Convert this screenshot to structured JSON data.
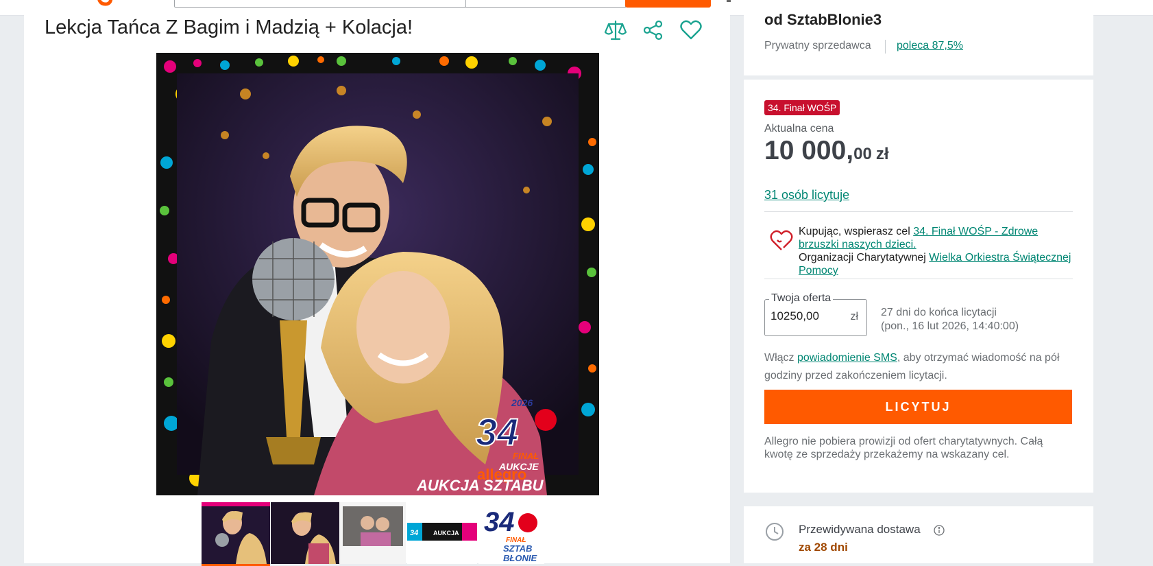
{
  "product": {
    "title": "Lekcja Tańca Z Bagim i Madzią + Kolacja!",
    "photo": {
      "logo_year": "2026",
      "logo_number": "34",
      "logo_final": "FINAŁ",
      "logo_aukcje": "AUKCJE",
      "logo_brand": "allegro",
      "banner": "AUKCJA SZTABU"
    },
    "thumbnails": [
      {
        "label": "zdjęcie 1",
        "selected": true
      },
      {
        "label": "zdjęcie 2",
        "selected": false
      },
      {
        "label": "zdjęcie 3",
        "selected": false
      },
      {
        "label": "zdjęcie 4",
        "selected": false
      },
      {
        "label": "zdjęcie 5",
        "selected": false
      }
    ],
    "thumb5_text": {
      "top": "34",
      "line2": "FINAŁ",
      "line3": "SZTAB",
      "line4": "BŁONIE"
    },
    "thumb4_text": {
      "a": "34",
      "b": "AUKCJA"
    }
  },
  "seller": {
    "name": "od SztabBlonie3",
    "type": "Prywatny sprzedawca",
    "recommend": "poleca 87,5%"
  },
  "offer": {
    "badge": "34. Finał WOŚP",
    "price_label": "Aktualna cena",
    "price_main": "10 000,",
    "price_decimals": "00",
    "price_currency": "zł",
    "bidders": "31 osób licytuje",
    "charity": {
      "prefix": "Kupując, wspierasz cel ",
      "goal": "34. Finał WOŚP - Zdrowe brzuszki naszych dzieci.",
      "org_prefix": "Organizacji Charytatywnej ",
      "org": "Wielka Orkiestra Świątecznej Pomocy"
    },
    "your_offer_label": "Twoja oferta",
    "your_offer_value": "10250,00",
    "your_offer_currency": "zł",
    "deadline_line1": "27 dni do końca licytacji",
    "deadline_line2": "(pon., 16 lut 2026, 14:40:00)",
    "sms_prefix": "Włącz ",
    "sms_link": "powiadomienie SMS",
    "sms_suffix": ", aby otrzymać wiadomość na pół godziny przed zakończeniem licytacji.",
    "bid_button": "LICYTUJ",
    "fee_note": "Allegro nie pobiera prowizji od ofert charytatywnych. Całą kwotę ze sprzedaży przekażemy na wskazany cel."
  },
  "delivery": {
    "label": "Przewidywana dostawa",
    "value": "za 28 dni"
  },
  "colors": {
    "accent": "#ff5a00",
    "link": "#008673",
    "badge": "#c8102e",
    "delivery": "#a04800"
  },
  "icons": [
    "compare-icon",
    "share-icon",
    "heart-icon",
    "charity-heart-icon",
    "clock-icon",
    "info-icon"
  ]
}
